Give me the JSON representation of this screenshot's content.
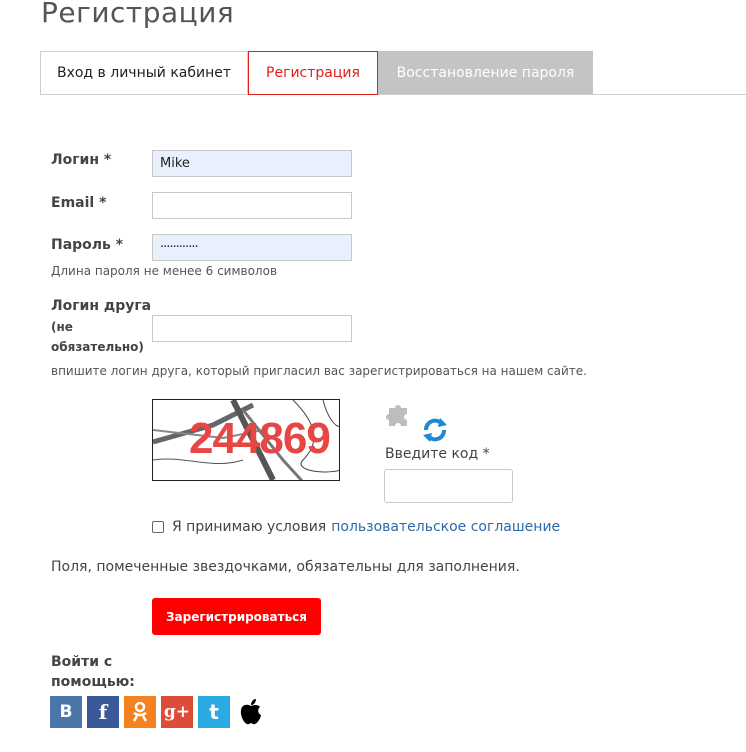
{
  "page_title": "Регистрация",
  "tabs": {
    "login": "Вход в личный кабинет",
    "register": "Регистрация",
    "recover": "Восстановление пароля"
  },
  "form": {
    "login_label": "Логин *",
    "login_value": "Mike",
    "email_label": "Email *",
    "email_value": "",
    "password_label": "Пароль *",
    "password_value": "············",
    "password_hint": "Длина пароля не менее 6 символов",
    "friend_label": "Логин друга",
    "friend_label_optional_1": "(не",
    "friend_label_optional_2": "обязательно)",
    "friend_value": "",
    "friend_hint": "впишите логин друга, который пригласил вас зарегистрироваться на нашем сайте."
  },
  "captcha": {
    "text": "244869",
    "code_label": "Введите код *",
    "code_value": ""
  },
  "agreement": {
    "text": "Я принимаю условия",
    "link": "пользовательское соглашение",
    "checked": false
  },
  "required_note": "Поля, помеченные звездочками, обязательны для заполнения.",
  "submit_label": "Зарегистрироваться",
  "social": {
    "label": "Войти с помощью:",
    "items": [
      {
        "name": "vk-icon",
        "glyph": "B",
        "color": "#4a76a8"
      },
      {
        "name": "facebook-icon",
        "glyph": "f",
        "color": "#3b5998"
      },
      {
        "name": "odnoklassniki-icon",
        "glyph": "ok",
        "color": "#f58220"
      },
      {
        "name": "google-plus-icon",
        "glyph": "g+",
        "color": "#dd4b39"
      },
      {
        "name": "twitter-icon",
        "glyph": "t",
        "color": "#2ba9e1"
      },
      {
        "name": "apple-icon",
        "glyph": "apple",
        "color": "#000000"
      }
    ]
  },
  "colors": {
    "accent": "#e0201c",
    "submit": "#ff0000",
    "link": "#2c6aa8",
    "tab_inactive_bg": "#c3c5c5",
    "autofill_bg": "#e8f0fe"
  }
}
